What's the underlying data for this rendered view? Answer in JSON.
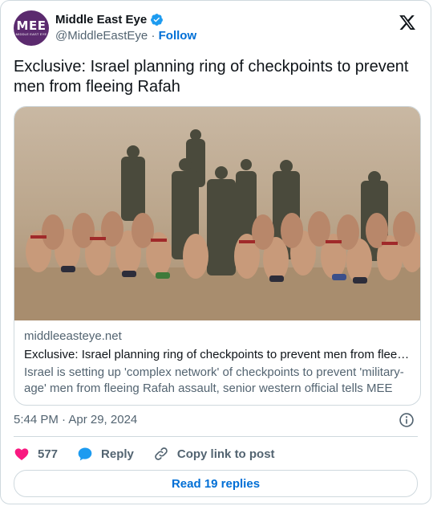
{
  "author": {
    "name": "Middle East Eye",
    "handle": "@MiddleEastEye",
    "follow_label": "Follow",
    "avatar_text": "MEE",
    "avatar_subtext": "MIDDLE EAST EYE",
    "verified_icon": "verified-badge-icon"
  },
  "tweet": {
    "text": "Exclusive: Israel planning ring of checkpoints to prevent men from fleeing Rafah"
  },
  "link_card": {
    "domain": "middleeasteye.net",
    "title": "Exclusive: Israel planning ring of checkpoints to prevent men from fleei…",
    "description": "Israel is setting up 'complex network' of checkpoints to prevent 'military-age' men from fleeing Rafah assault, senior western official tells MEE"
  },
  "meta": {
    "timestamp": "5:44 PM · Apr 29, 2024"
  },
  "actions": {
    "likes_count": "577",
    "reply_label": "Reply",
    "copy_label": "Copy link to post"
  },
  "footer": {
    "read_replies_label": "Read 19 replies"
  },
  "colors": {
    "link_blue": "#006fd6",
    "heart_red": "#f91880",
    "reply_blue": "#1d9bf0",
    "avatar_purple": "#5b2a6e",
    "border": "#cfd9de",
    "secondary_text": "#536471"
  }
}
